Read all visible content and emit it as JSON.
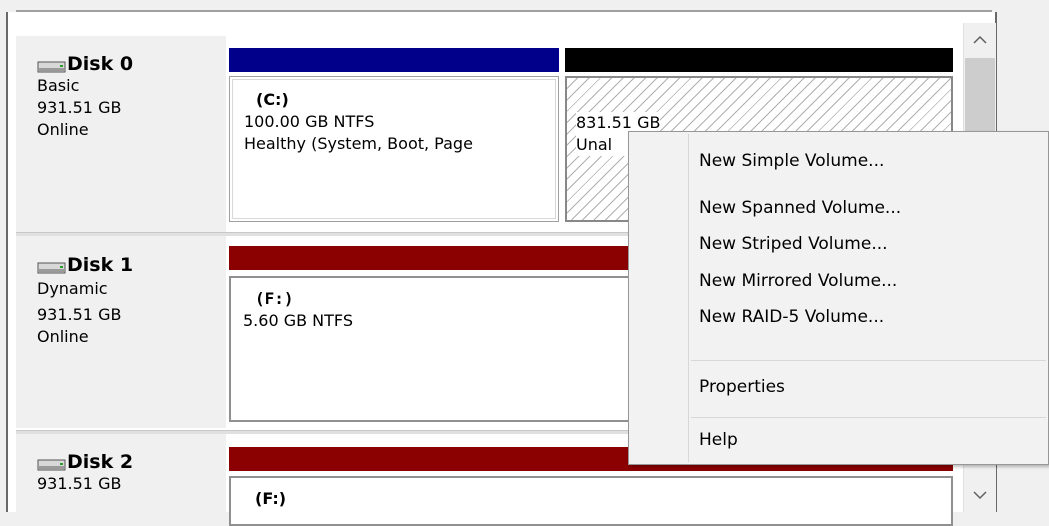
{
  "disks": [
    {
      "name": "Disk 0",
      "info": [
        "Basic",
        "931.51 GB",
        "Online"
      ]
    },
    {
      "name": "Disk 1",
      "info": [
        "Dynamic",
        "931.51 GB",
        "Online"
      ]
    },
    {
      "name": "Disk 2",
      "info": [
        "931.51 GB"
      ]
    }
  ],
  "partitions": {
    "disk0_c": {
      "volume": "(C:)",
      "size": "100.00 GB NTFS",
      "status": "Healthy (System, Boot, Page"
    },
    "disk0_unalloc": {
      "size": "831.51 GB",
      "status": "Unal"
    },
    "disk1_f": {
      "volume": "(F:)",
      "size": "5.60 GB NTFS"
    },
    "disk2_f": {
      "volume": "(F:)"
    }
  },
  "colors": {
    "primary_bar": "#00008b",
    "unallocated_bar": "#000000",
    "spanned_bar": "#8b0000"
  },
  "scrollbar": {
    "up_icon": "chevron-up-icon",
    "down_icon": "chevron-down-icon",
    "up_glyph": "^",
    "down_glyph": "v"
  },
  "context_menu": {
    "items": [
      "New Simple Volume...",
      "New Spanned Volume...",
      "New Striped Volume...",
      "New Mirrored Volume...",
      "New RAID-5 Volume...",
      "Properties",
      "Help"
    ]
  }
}
